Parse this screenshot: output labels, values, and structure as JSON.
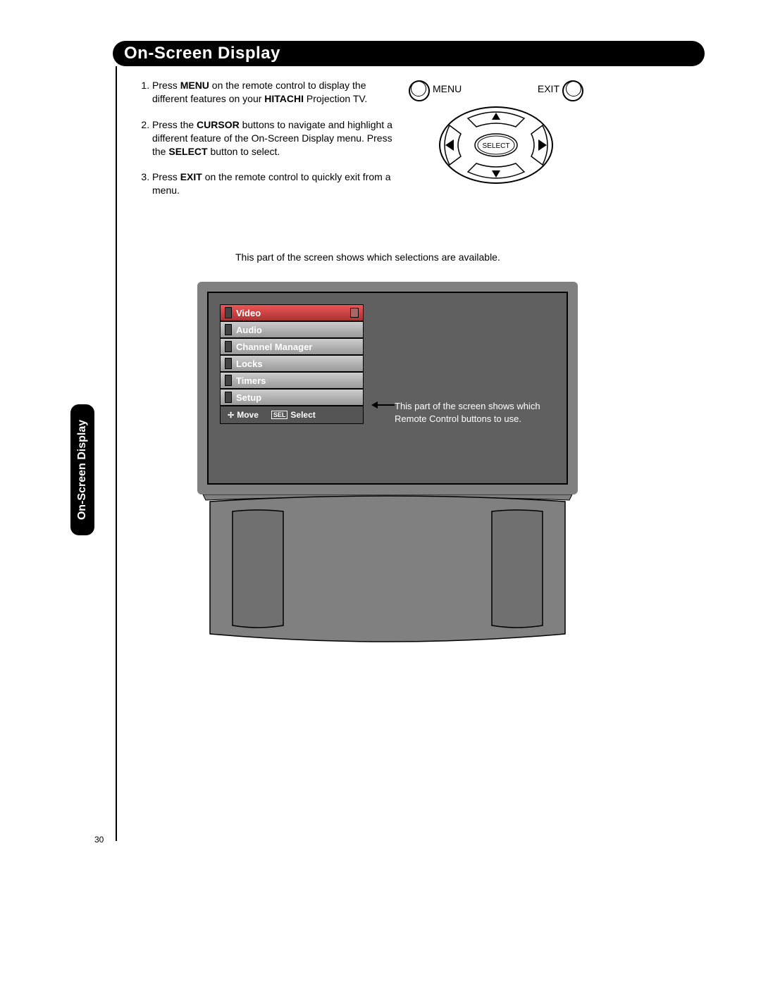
{
  "title": "On-Screen Display",
  "side_tab": "On-Screen Display",
  "page_number": "30",
  "instructions": {
    "item1_pre": "Press ",
    "item1_b1": "MENU",
    "item1_mid": " on the remote control to display the different features on your ",
    "item1_b2": "HITACHI",
    "item1_post": " Projection TV.",
    "item2_pre": "Press the ",
    "item2_b1": "CURSOR",
    "item2_mid": " buttons to navigate and highlight a different feature of the On-Screen Display menu. Press the ",
    "item2_b2": "SELECT",
    "item2_post": " button to select.",
    "item3_pre": "Press ",
    "item3_b1": "EXIT",
    "item3_post": " on the remote control to quickly exit from a menu."
  },
  "remote": {
    "menu_label": "MENU",
    "exit_label": "EXIT",
    "select_label": "SELECT"
  },
  "caption_top": "This part of the screen shows which selections are available.",
  "caption_right": "This part of the screen shows which Remote Control buttons to use.",
  "osd": {
    "items": [
      "Video",
      "Audio",
      "Channel Manager",
      "Locks",
      "Timers",
      "Setup"
    ],
    "footer_move": "Move",
    "footer_sel_tag": "SEL",
    "footer_select": "Select"
  }
}
